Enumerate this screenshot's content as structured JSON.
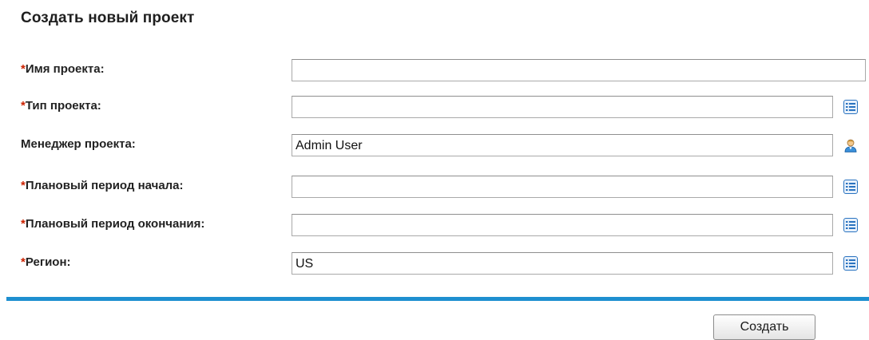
{
  "form": {
    "title": "Создать новый проект",
    "required_marker": "*",
    "fields": [
      {
        "label": "Имя проекта:",
        "required": true,
        "value": "",
        "icon": null
      },
      {
        "label": "Тип проекта:",
        "required": true,
        "value": "",
        "icon": "list-icon"
      },
      {
        "label": "Менеджер проекта:",
        "required": false,
        "value": "Admin User",
        "icon": "user-icon"
      },
      {
        "label": "Плановый период начала:",
        "required": true,
        "value": "",
        "icon": "list-icon"
      },
      {
        "label": "Плановый период окончания:",
        "required": true,
        "value": "",
        "icon": "list-icon"
      },
      {
        "label": "Регион:",
        "required": true,
        "value": "US",
        "icon": "list-icon"
      }
    ],
    "submit_label": "Создать"
  },
  "colors": {
    "accent_bar": "#1e8fd0",
    "required": "#cc2200",
    "list_icon": "#2a73c0"
  }
}
